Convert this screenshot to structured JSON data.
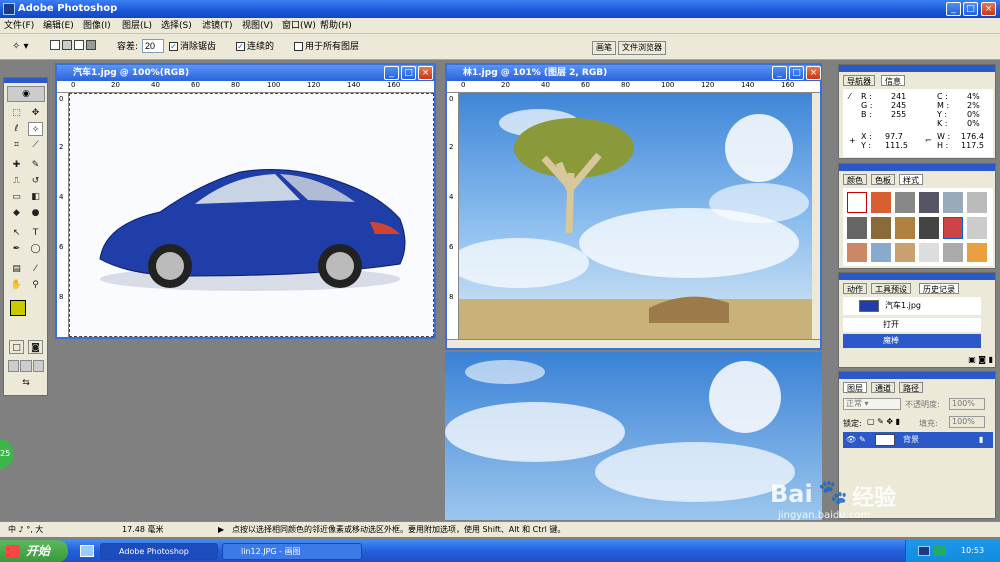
{
  "window": {
    "title": "Adobe Photoshop"
  },
  "menus": [
    "文件(F)",
    "编辑(E)",
    "图像(I)",
    "图层(L)",
    "选择(S)",
    "滤镜(T)",
    "视图(V)",
    "窗口(W)",
    "帮助(H)"
  ],
  "options": {
    "tolerance_label": "容差:",
    "tolerance_value": "20",
    "antialias_label": "消除锯齿",
    "contiguous_label": "连续的",
    "all_layers_label": "用于所有图层"
  },
  "palette_tabs": [
    "画笔",
    "文件浏览器"
  ],
  "doc1": {
    "title": "汽车1.jpg @ 100%(RGB)",
    "ruler": [
      "0",
      "20",
      "40",
      "60",
      "80",
      "100",
      "120",
      "140",
      "160"
    ],
    "vruler": [
      "0",
      "2",
      "4",
      "6",
      "8"
    ]
  },
  "doc2": {
    "title": "林1.jpg @ 101% (图层 2, RGB)",
    "ruler": [
      "0",
      "20",
      "40",
      "60",
      "80",
      "100",
      "120",
      "140",
      "160"
    ],
    "vruler": [
      "0",
      "2",
      "4",
      "6",
      "8"
    ]
  },
  "navigator": {
    "tabs": [
      "导航器",
      "信息"
    ],
    "r": "241",
    "g": "245",
    "b": "255",
    "c": "4%",
    "m": "2%",
    "y": "0%",
    "k": "0%",
    "x": "97.7",
    "yv": "111.5",
    "w": "176.4",
    "h": "117.5",
    "lbl_r": "R :",
    "lbl_g": "G :",
    "lbl_b": "B :",
    "lbl_c": "C :",
    "lbl_m": "M :",
    "lbl_y": "Y :",
    "lbl_k": "K :",
    "lbl_x": "X :",
    "lbl_yv": "Y :",
    "lbl_w": "W :",
    "lbl_h": "H :"
  },
  "swatches": {
    "tabs": [
      "颜色",
      "色板",
      "样式"
    ]
  },
  "history": {
    "tabs": [
      "动作",
      "工具预设",
      "历史记录"
    ],
    "snapshot": "汽车1.jpg",
    "items": [
      "打开",
      "魔棒"
    ]
  },
  "layers": {
    "tabs": [
      "图层",
      "通道",
      "路径"
    ],
    "mode": "正常",
    "opacity_label": "不透明度:",
    "opacity": "100%",
    "lock_label": "锁定:",
    "fill_label": "填充:",
    "fill": "100%",
    "layer_name": "背景"
  },
  "status": {
    "zoom": "17.48 毫米",
    "hint": "点按以选择相同颜色的邻近像素或移动选区外框。要用附加选项，使用 Shift、Alt 和 Ctrl 键。",
    "ime": "中 ♪ °, 大"
  },
  "taskbar": {
    "start": "开始",
    "tasks": [
      "Adobe Photoshop",
      "lin12.JPG - 画图"
    ],
    "clock": "10:53"
  },
  "badge": "25",
  "watermark": {
    "brand": "Bai",
    "brand2": "经验",
    "url": "jingyan.baidu.com"
  }
}
